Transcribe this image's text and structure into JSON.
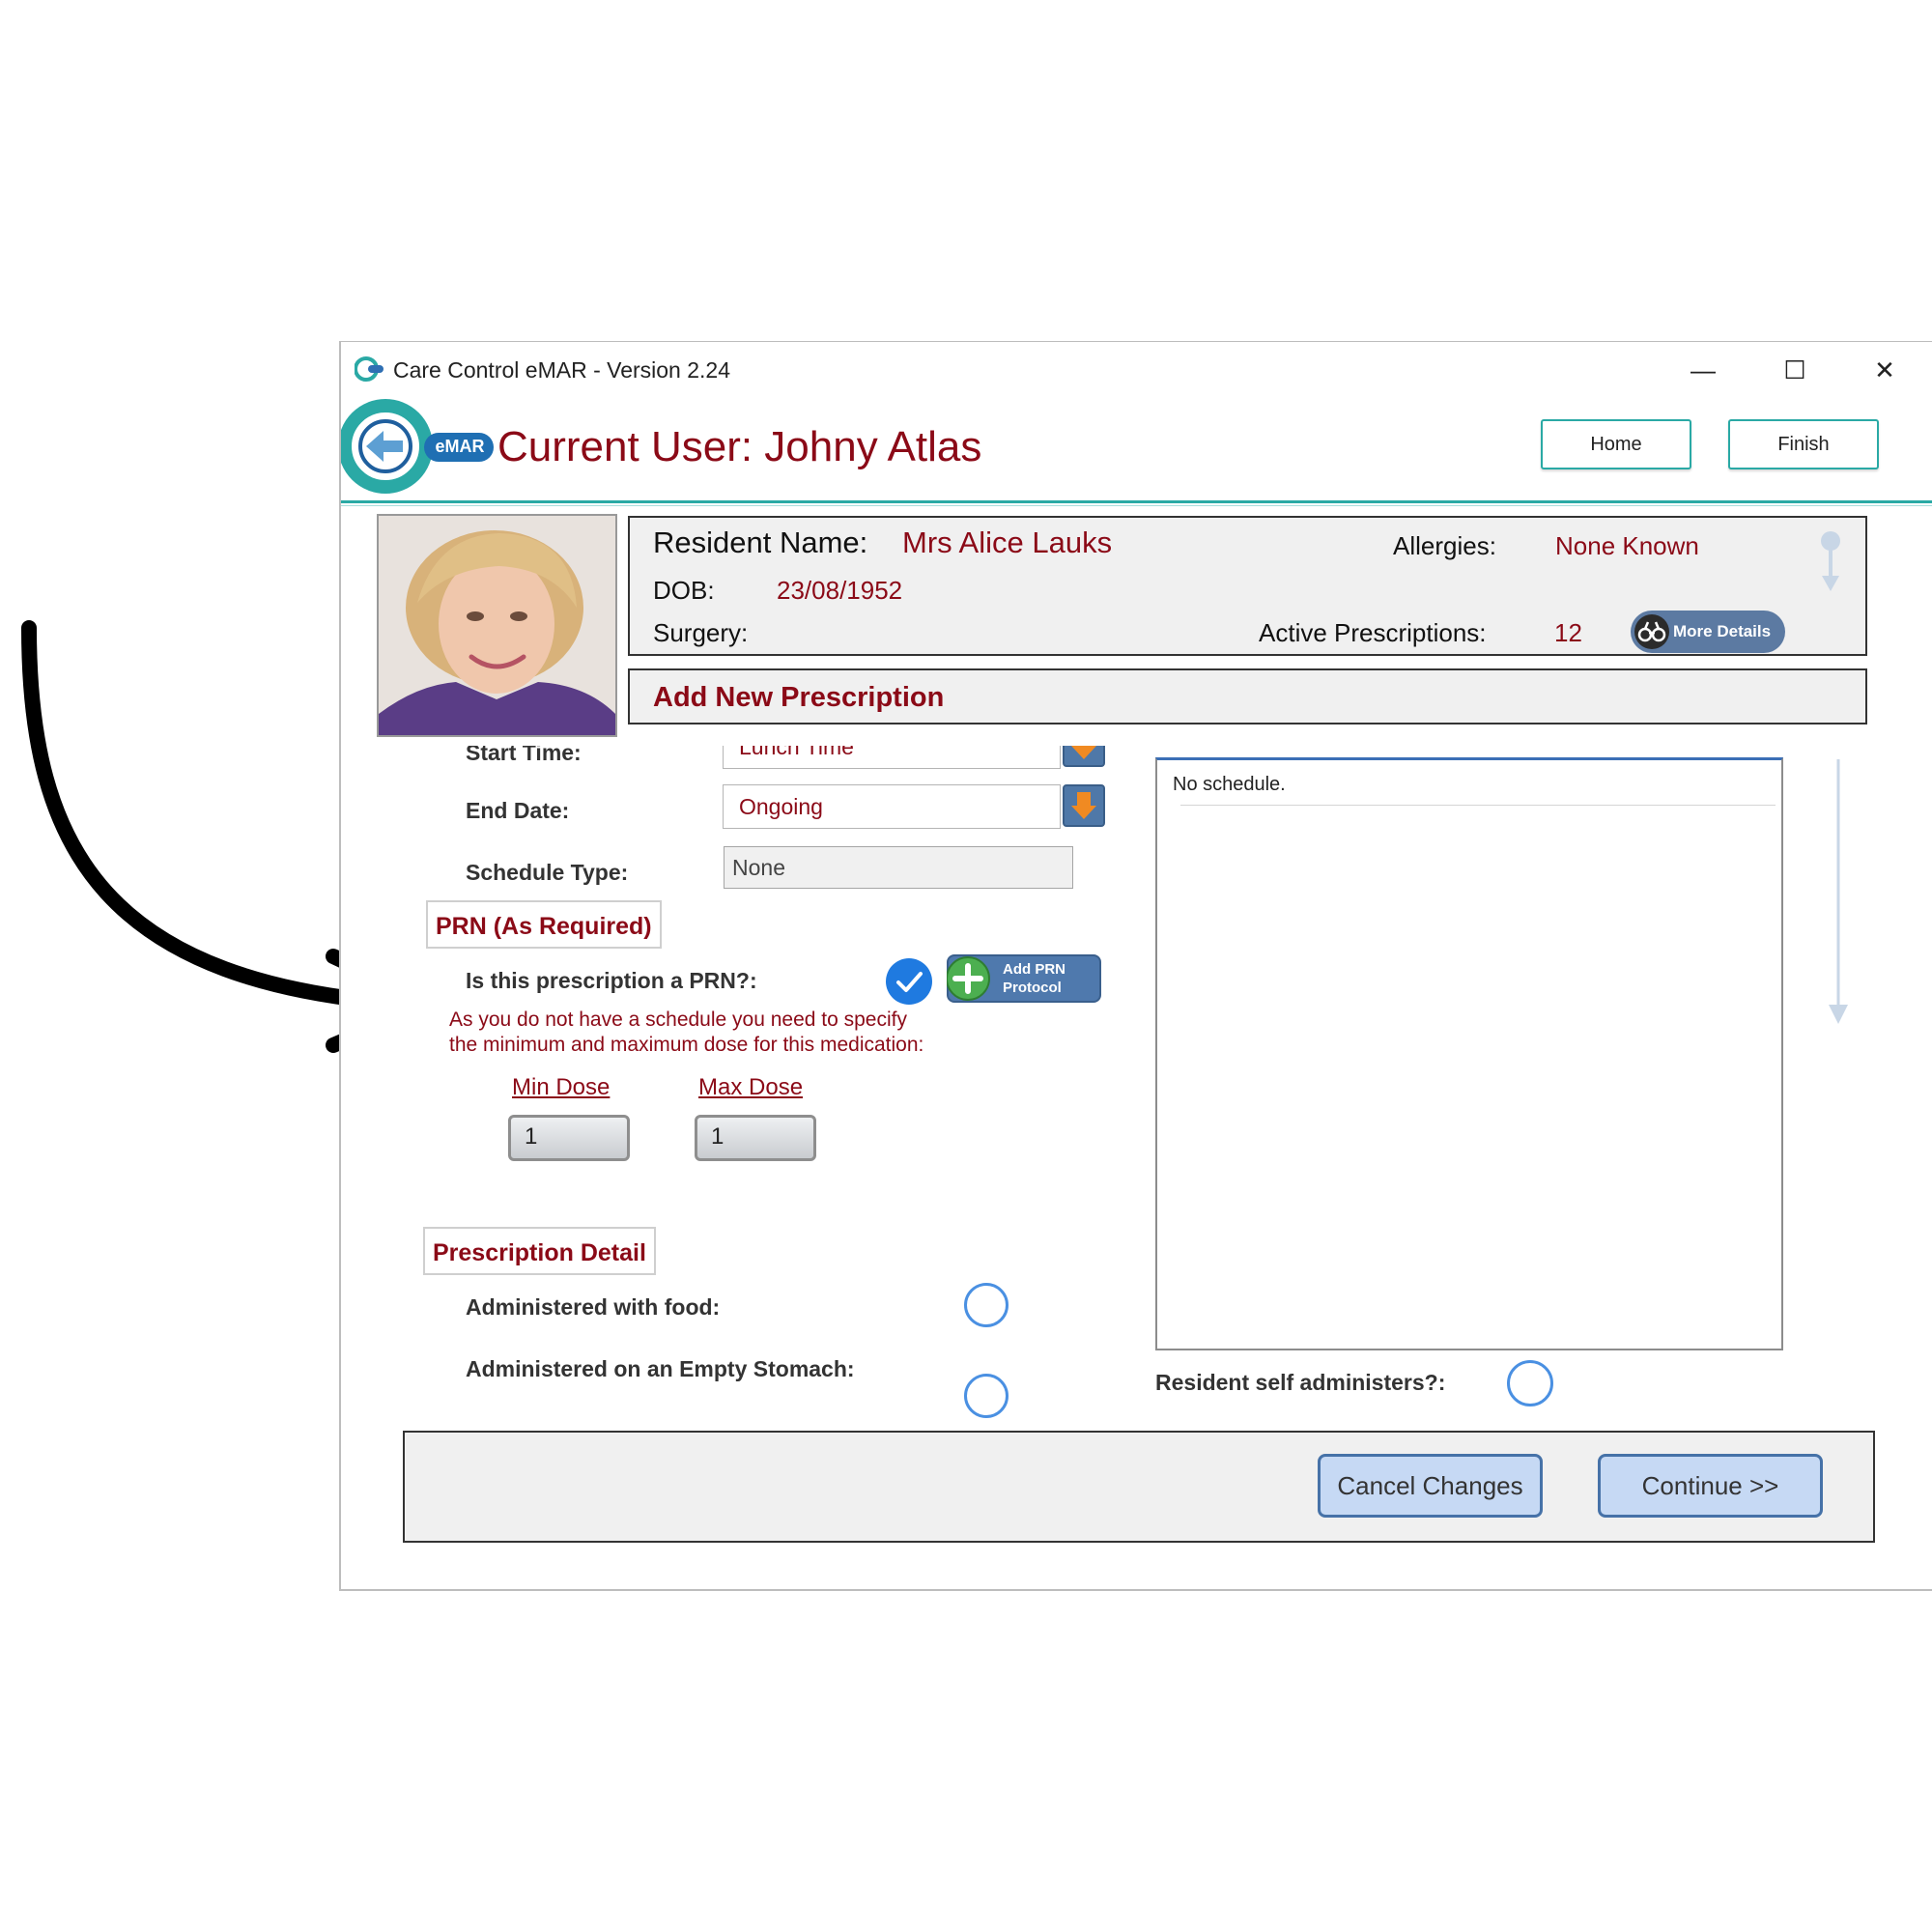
{
  "window": {
    "title": "Care Control eMAR - Version 2.24",
    "controls": {
      "minimize": "—",
      "maximize": "☐",
      "close": "✕"
    }
  },
  "header": {
    "logo_badge": "eMAR",
    "current_user": "Current User: Johny Atlas",
    "home_label": "Home",
    "finish_label": "Finish"
  },
  "resident": {
    "name_label": "Resident Name:",
    "name_value": "Mrs Alice Lauks",
    "dob_label": "DOB:",
    "dob_value": "23/08/1952",
    "surgery_label": "Surgery:",
    "allergies_label": "Allergies:",
    "allergies_value": "None Known",
    "active_label": "Active Prescriptions:",
    "active_value": "12",
    "more_details_label": "More Details"
  },
  "page": {
    "title": "Add New Prescription"
  },
  "form": {
    "start_time_label": "Start Time:",
    "start_time_value": "Lunch Time",
    "end_date_label": "End Date:",
    "end_date_value": "Ongoing",
    "schedule_type_label": "Schedule Type:",
    "schedule_type_value": "None"
  },
  "prn": {
    "section_title": "PRN (As Required)",
    "question": "Is this prescription a PRN?:",
    "is_prn": true,
    "add_protocol_line1": "Add PRN",
    "add_protocol_line2": "Protocol",
    "note_line1": "As you do not have a schedule you need to specify",
    "note_line2": "the minimum and maximum dose for this medication:",
    "min_dose_label": "Min Dose",
    "min_dose_value": "1",
    "max_dose_label": "Max Dose",
    "max_dose_value": "1"
  },
  "detail": {
    "section_title": "Prescription Detail",
    "with_food_label": "Administered with food:",
    "empty_stomach_label": "Administered on an Empty Stomach:",
    "self_administers_label": "Resident self administers?:"
  },
  "schedule": {
    "empty_text": "No schedule."
  },
  "footer": {
    "cancel_label": "Cancel Changes",
    "continue_label": "Continue >>"
  },
  "colors": {
    "accent_teal": "#2aa9a5",
    "label_red": "#8b0a17",
    "button_blue": "#c6d9f4",
    "checkbox_blue": "#1f7ae0"
  }
}
